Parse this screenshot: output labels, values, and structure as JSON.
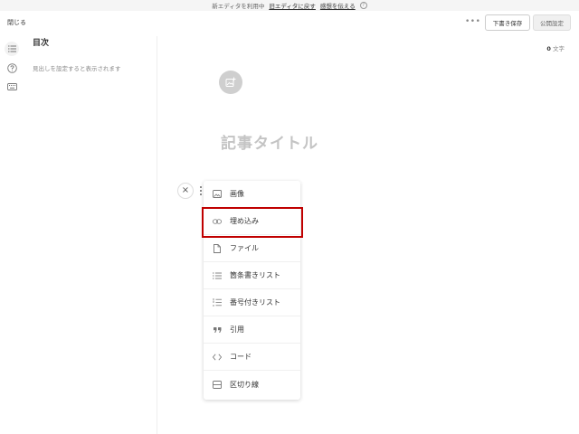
{
  "banner": {
    "notice": "新エディタを利用中",
    "legacy_link": "旧エディタに戻す",
    "feedback_link": "感想を伝える",
    "help_icon_glyph": "?"
  },
  "header": {
    "close_label": "閉じる",
    "more_glyph": "•••",
    "draft_label": "下書き保存",
    "publish_label": "公開設定"
  },
  "rail": {
    "icons": [
      "list-icon",
      "help-circle-icon",
      "keyboard-icon"
    ]
  },
  "toc": {
    "title": "目次",
    "hint": "見出しを設定すると表示されます"
  },
  "editor": {
    "char_count_value": "0",
    "char_count_unit": "文字",
    "title_placeholder": "記事タイトル"
  },
  "insert_menu": {
    "close_glyph": "×",
    "items": [
      {
        "label": "画像",
        "icon": "image-icon"
      },
      {
        "label": "埋め込み",
        "icon": "link-icon"
      },
      {
        "label": "ファイル",
        "icon": "file-icon"
      },
      {
        "label": "箇条書きリスト",
        "icon": "bullet-list-icon"
      },
      {
        "label": "番号付きリスト",
        "icon": "numbered-list-icon"
      },
      {
        "label": "引用",
        "icon": "quote-icon"
      },
      {
        "label": "コード",
        "icon": "code-icon"
      },
      {
        "label": "区切り線",
        "icon": "divider-icon"
      }
    ],
    "highlighted_item": "埋め込み"
  },
  "colors": {
    "highlight": "#c00000",
    "placeholder": "#c4c4c4",
    "upload_circle": "#cfcfcf"
  }
}
